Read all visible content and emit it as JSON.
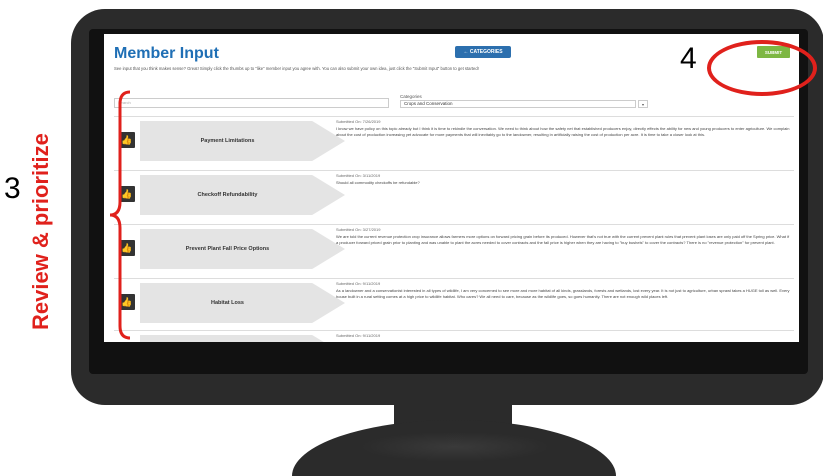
{
  "app": {
    "title": "Member Input",
    "intro": "See input that you think makes sense? Great! Simply click the thumbs up to \"like\" member input you agree with. You can also submit your own idea, just click the \"Submit Input\" button to get started!",
    "categories_button": "CATEGORIES",
    "submit_button": "SUBMIT",
    "search_placeholder": "Search",
    "categories_label": "Categories",
    "categories_value": "Crops and Conservation",
    "caret": "▾"
  },
  "items": [
    {
      "title": "Payment Limitations",
      "submitted": "Submitted On: 7/26/2019",
      "body": "I know we have policy on this topic already but I think it is time to rekindle the conversation. We need to think about how the safety net that established producers enjoy, directly effects the ability for new and young producers to enter agriculture. We complain about the cost of production increasing yet advocate for more payments that will inevitably go to the landowner, resulting in artificially raising the cost of production per acre. It is time to take a closer look at this."
    },
    {
      "title": "Checkoff Refundability",
      "submitted": "Submitted On: 3/11/2019",
      "body": "Should all commodity checkoffs be refundable?"
    },
    {
      "title": "Prevent Plant Fall Price Options",
      "submitted": "Submitted On: 3/27/2019",
      "body": "We are told the current revenue protection crop insurance allows farmers more options on forward pricing grain before its produced. However that's not true with the current prevent plant rules that prevent plant loses are only paid off the Spring price. What if a producer forward priced grain prior to planting and was unable to plant the acres needed to cover contracts and the fall price is higher when they are having to \"buy bushels\" to cover the contracts? There is no \"revenue protection\" for prevent plant."
    },
    {
      "title": "Habitat Loss",
      "submitted": "Submitted On: 9/11/2019",
      "body": "As a landowner and a conservationist interested in all types of wildlife, I am very concerned to see more and more habitat of all kinds, grasslands, forests and wetlands, lost every year. It is not just to agriculture, urban sprawl takes a HUGE toll as well. Every house built in a rural setting comes at a high price to wildlife habitat. Who cares? We all need to care, because as the wildlife goes, so goes humanity. There are not enough wild places left."
    },
    {
      "title": "",
      "submitted": "Submitted On: 9/11/2019",
      "body": ""
    }
  ],
  "annotations": {
    "step4": "4",
    "step3": "3",
    "review": "Review & prioritize"
  },
  "colors": {
    "title_blue": "#1f6fb5",
    "submit_green": "#7db743",
    "annotation_red": "#e0211c"
  }
}
